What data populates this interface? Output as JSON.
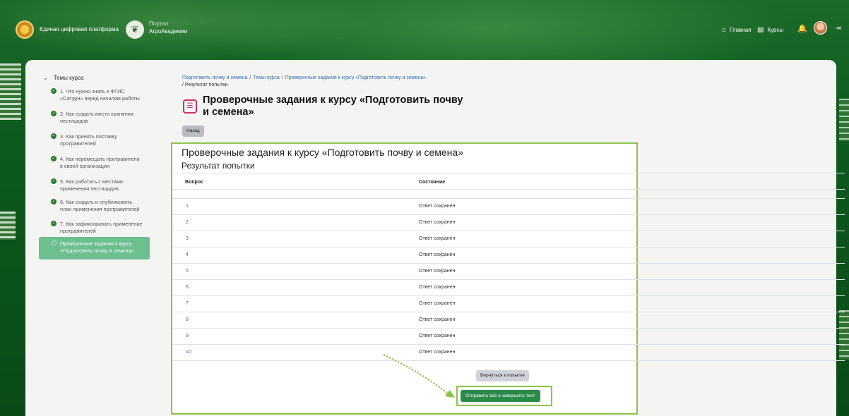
{
  "header": {
    "platform_label": "Единая цифровая платформа",
    "portal_line1": "Портал",
    "portal_line2": "АгроАкадемии",
    "nav_home": "Главная",
    "nav_courses": "Курсы"
  },
  "sidebar": {
    "title": "Темы курса",
    "items": [
      {
        "label_l1": "1. Что нужно знать о ФГИС",
        "label_l2": "«Сатурн» перед началом работы"
      },
      {
        "label_l1": "2. Как создать место хранения",
        "label_l2": "пестицидов"
      },
      {
        "label_l1": "3. Как принять поставку",
        "label_l2": "протравителей"
      },
      {
        "label_l1": "4. Как перемещать протравители",
        "label_l2": "в своей организации"
      },
      {
        "label_l1": "5. Как работать с местами",
        "label_l2": "применения пестицидов"
      },
      {
        "label_l1": "6. Как создать и опубликовать",
        "label_l2": "план применения протравителей"
      },
      {
        "label_l1": "7. Как зафиксировать применение",
        "label_l2": "протравителей"
      }
    ],
    "active": {
      "label_l1": "Проверочные задания к курсу",
      "label_l2": "«Подготовить почву и семена»"
    }
  },
  "breadcrumb": {
    "c1": "Подготовить почву и семена",
    "c2": "Темы курса",
    "c3": "Проверочные задания к курсу «Подготовить почву и семена»",
    "c4": "Результат попытки",
    "sep": "/"
  },
  "page": {
    "title_l1": "Проверочные задания к курсу «Подготовить почву",
    "title_l2": "и семена»",
    "back_label": "Назад"
  },
  "summary": {
    "title": "Проверочные задания к курсу «Подготовить почву и семена»",
    "subtitle": "Результат попытки",
    "col_question": "Вопрос",
    "col_state": "Состояние",
    "rows": [
      {
        "q": "1",
        "state": "Ответ сохранен"
      },
      {
        "q": "2",
        "state": "Ответ сохранен"
      },
      {
        "q": "3",
        "state": "Ответ сохранен"
      },
      {
        "q": "4",
        "state": "Ответ сохранен"
      },
      {
        "q": "5",
        "state": "Ответ сохранен"
      },
      {
        "q": "6",
        "state": "Ответ сохранен"
      },
      {
        "q": "7",
        "state": "Ответ сохранен"
      },
      {
        "q": "8",
        "state": "Ответ сохранен"
      },
      {
        "q": "9",
        "state": "Ответ сохранен"
      },
      {
        "q": "10",
        "state": "Ответ сохранен"
      }
    ],
    "return_label": "Вернуться к попытке",
    "submit_label": "Отправить всё и завершить тест"
  },
  "colors": {
    "accent_green": "#2a8a4a",
    "highlight": "#8bc34a",
    "link": "#2f6db2",
    "active_item": "#6cbf8e"
  }
}
